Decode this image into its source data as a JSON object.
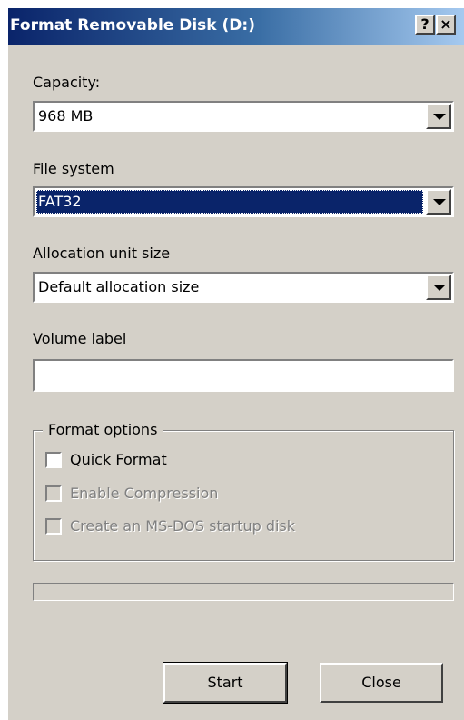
{
  "window": {
    "title": "Format Removable Disk (D:)",
    "help_button": "?",
    "close_button": "×"
  },
  "capacity": {
    "label": "Capacity:",
    "value": "968 MB"
  },
  "file_system": {
    "label": "File system",
    "value": "FAT32"
  },
  "allocation_unit": {
    "label": "Allocation unit size",
    "value": "Default allocation size"
  },
  "volume_label": {
    "label": "Volume label",
    "value": ""
  },
  "format_options": {
    "legend": "Format options",
    "quick_format": {
      "label": "Quick Format",
      "checked": false,
      "enabled": true
    },
    "enable_compression": {
      "label": "Enable Compression",
      "checked": false,
      "enabled": false
    },
    "msdos_startup": {
      "label": "Create an MS-DOS startup disk",
      "checked": false,
      "enabled": false
    }
  },
  "progress": {
    "fraction": 0
  },
  "buttons": {
    "start": "Start",
    "close": "Close"
  },
  "colors": {
    "dialog_face": "#d4d0c8",
    "title_gradient_start": "#0a246a",
    "title_gradient_end": "#a6caf0",
    "selection": "#0a246a",
    "disabled_text": "#808080"
  }
}
